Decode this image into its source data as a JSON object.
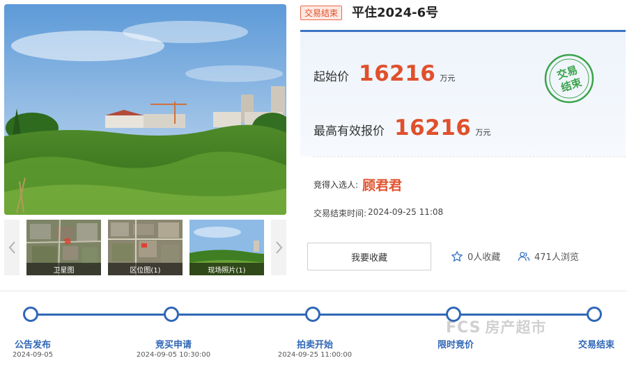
{
  "listing": {
    "status_tag": "交易结束",
    "title": "平住2024-6号"
  },
  "gallery": {
    "thumbnails": [
      {
        "caption": "卫星图"
      },
      {
        "caption": "区位图(1)"
      },
      {
        "caption": "现场照片(1)"
      }
    ]
  },
  "price": {
    "start_label": "起始价",
    "start_value": "16216",
    "start_unit": "万元",
    "max_label": "最高有效报价",
    "max_value": "16216",
    "max_unit": "万元",
    "stamp_line1": "交易",
    "stamp_line2": "结束"
  },
  "result": {
    "winner_label": "竞得入选人:",
    "winner_name": "顾君君",
    "endtime_label": "交易结束时间:",
    "endtime_value": "2024-09-25 11:08"
  },
  "actions": {
    "favorite_label": "我要收藏",
    "favorite_count": "0人收藏",
    "view_count": "471人浏览"
  },
  "timeline": [
    {
      "label": "公告发布",
      "date": "2024-09-05"
    },
    {
      "label": "竞买申请",
      "date": "2024-09-05 10:30:00"
    },
    {
      "label": "拍卖开始",
      "date": "2024-09-25 11:00:00"
    },
    {
      "label": "限时竞价",
      "date": ""
    },
    {
      "label": "交易结束",
      "date": ""
    }
  ],
  "watermark": {
    "brand": "FCS",
    "text": "房产超市"
  },
  "colors": {
    "accent": "#2f67b6",
    "price": "#e0502c",
    "stamp": "#3aa34a"
  }
}
